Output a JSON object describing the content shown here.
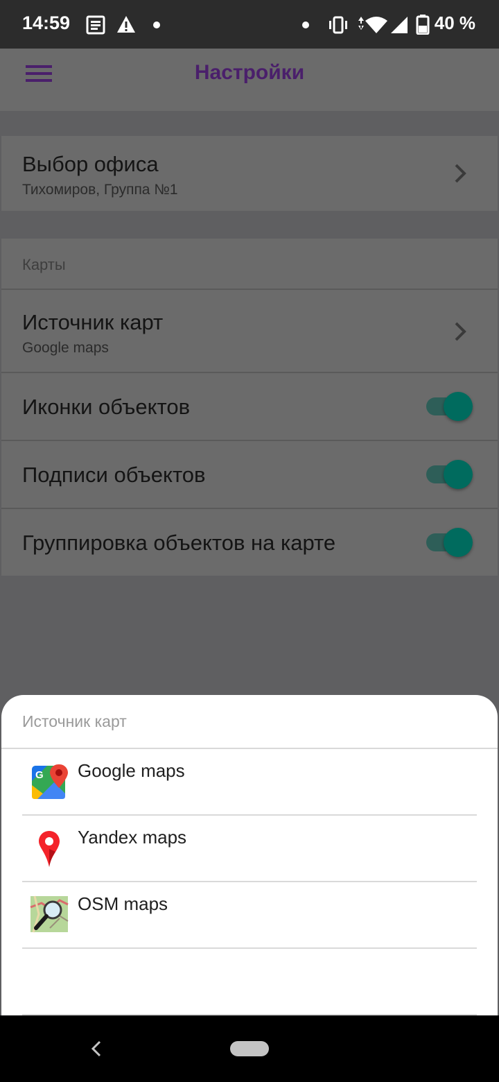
{
  "status_bar": {
    "time": "14:59",
    "battery_text": "40 %",
    "icons": [
      "news-icon",
      "warning-icon",
      "dot-icon",
      "dot-icon",
      "vibrate-icon",
      "wifi-icon",
      "signal-icon",
      "battery-icon"
    ]
  },
  "app_bar": {
    "title": "Настройки",
    "menu_icon": "hamburger-menu-icon"
  },
  "settings": {
    "office": {
      "title": "Выбор офиса",
      "subtitle": "Тихомиров, Группа №1"
    },
    "maps_section_label": "Карты",
    "map_source": {
      "title": "Источник карт",
      "subtitle": "Google maps"
    },
    "toggles": [
      {
        "label": "Иконки объектов",
        "on": true
      },
      {
        "label": "Подписи объектов",
        "on": true
      },
      {
        "label": "Группировка объектов на карте",
        "on": true
      }
    ]
  },
  "sheet": {
    "title": "Источник карт",
    "options": [
      {
        "label": "Google maps",
        "icon": "google-maps-icon"
      },
      {
        "label": "Yandex maps",
        "icon": "yandex-maps-icon"
      },
      {
        "label": "OSM maps",
        "icon": "osm-maps-icon"
      }
    ]
  },
  "colors": {
    "title_purple": "#4a1f6b",
    "toggle_teal": "#006b5e",
    "scrim": "#5f5f61"
  }
}
